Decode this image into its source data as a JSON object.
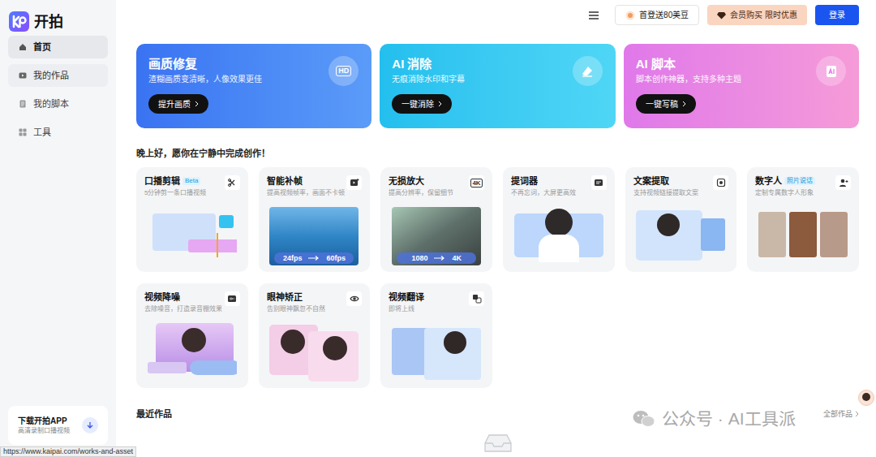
{
  "logo": {
    "text": "开拍"
  },
  "sidebar": {
    "items": [
      {
        "label": "首页",
        "kind": "home",
        "selected": true,
        "hovered": false
      },
      {
        "label": "我的作品",
        "kind": "works",
        "selected": false,
        "hovered": true
      },
      {
        "label": "我的脚本",
        "kind": "script",
        "selected": false,
        "hovered": false
      },
      {
        "label": "工具",
        "kind": "tools",
        "selected": false,
        "hovered": false
      }
    ]
  },
  "download": {
    "title": "下载开拍APP",
    "subtitle": "高清录制口播视频"
  },
  "status_url": "https://www.kaipai.com/works-and-asset",
  "header": {
    "buttons": [
      {
        "label": "首登送80美豆",
        "kind": "gift"
      },
      {
        "label": "会员购买 限时优惠",
        "kind": "vip"
      },
      {
        "label": "登录",
        "kind": "primary"
      }
    ]
  },
  "banners": [
    {
      "title": "画质修复",
      "subtitle": "渣糊画质变清晰，人像效果更佳",
      "button": "提升画质",
      "kind": "hd",
      "icon_text": "HD"
    },
    {
      "title": "AI 消除",
      "subtitle": "无痕消除水印和字幕",
      "button": "一键消除",
      "kind": "erase"
    },
    {
      "title": "AI 脚本",
      "subtitle": "脚本创作神器，支持多种主题",
      "button": "一键写稿",
      "kind": "script"
    }
  ],
  "greeting": "晚上好，愿你在宁静中完成创作！",
  "tools": [
    {
      "title": "口播剪辑",
      "badge": "Beta",
      "subtitle": "5分钟剪一条口播视频",
      "kind": "edit"
    },
    {
      "title": "智能补帧",
      "subtitle": "提高视频帧率，画面不卡顿",
      "kind": "frame",
      "captions": [
        "24fps",
        "60fps"
      ]
    },
    {
      "title": "无损放大",
      "subtitle": "提高分辨率，保留细节",
      "kind": "upscale",
      "icon_text": "4K",
      "captions": [
        "1080",
        "4K"
      ]
    },
    {
      "title": "提词器",
      "subtitle": "不再忘词，大屏更高效",
      "kind": "prompter"
    },
    {
      "title": "文案提取",
      "subtitle": "支持视频链接提取文案",
      "kind": "extract"
    },
    {
      "title": "数字人",
      "badge": "照片说话",
      "subtitle": "定制专属数字人形象",
      "kind": "avatar"
    },
    {
      "title": "视频降噪",
      "subtitle": "去除噪音，打造录音棚效果",
      "kind": "denoise"
    },
    {
      "title": "眼神矫正",
      "subtitle": "告别眼神飘忽不自然",
      "kind": "gaze"
    },
    {
      "title": "视频翻译",
      "subtitle": "即将上线",
      "kind": "translate"
    }
  ],
  "recent": {
    "title": "最近作品",
    "link": "全部作品"
  },
  "watermark": "公众号 · AI工具派"
}
